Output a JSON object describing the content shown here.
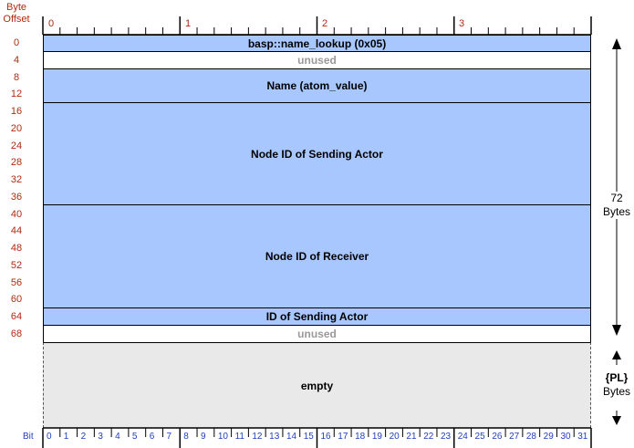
{
  "header": {
    "byte_line1": "Byte",
    "byte_line2": "Offset"
  },
  "byte_numbers": [
    "0",
    "1",
    "2",
    "3"
  ],
  "offsets": [
    "0",
    "4",
    "8",
    "12",
    "16",
    "20",
    "24",
    "28",
    "32",
    "36",
    "40",
    "44",
    "48",
    "52",
    "56",
    "60",
    "64",
    "68"
  ],
  "fields": {
    "f0": "basp::name_lookup (0x05)",
    "f1": "unused",
    "f2": "Name (atom_value)",
    "f3": "Node ID of Sending Actor",
    "f4": "Node ID of Receiver",
    "f5": "ID of Sending Actor",
    "f6": "unused",
    "f7": "empty"
  },
  "side": {
    "total_value": "72",
    "total_unit": "Bytes",
    "payload_value": "{PL}",
    "payload_unit": "Bytes"
  },
  "bit_label": "Bit",
  "bit_numbers": [
    "0",
    "1",
    "2",
    "3",
    "4",
    "5",
    "6",
    "7",
    "8",
    "9",
    "10",
    "11",
    "12",
    "13",
    "14",
    "15",
    "16",
    "17",
    "18",
    "19",
    "20",
    "21",
    "22",
    "23",
    "24",
    "25",
    "26",
    "27",
    "28",
    "29",
    "30",
    "31"
  ]
}
